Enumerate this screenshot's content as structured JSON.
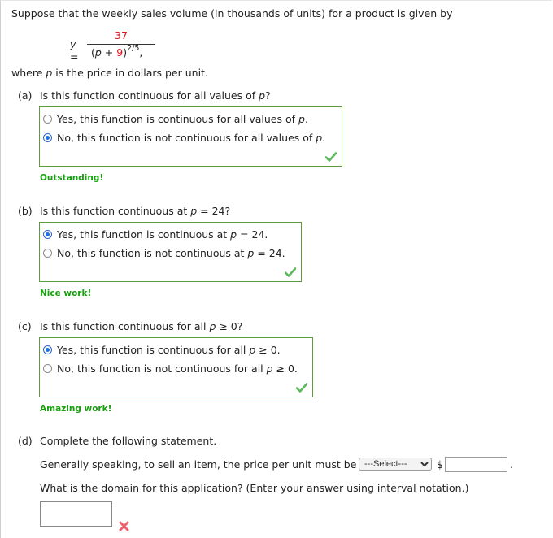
{
  "intro": {
    "text": "Suppose that the weekly sales volume (in thousands of units) for a product is given by",
    "formula": {
      "lhs": "y =",
      "numerator": "37",
      "denominator_open": "(",
      "denominator_var": "p",
      "denominator_plus": " + ",
      "denominator_const": "9",
      "denominator_close": ")",
      "exponent": "2/5",
      "trailing": ","
    },
    "where_prefix": "where ",
    "where_var": "p",
    "where_suffix": " is the price in dollars per unit."
  },
  "parts": [
    {
      "label": "(a)",
      "question_pre": "Is this function continuous for all values of ",
      "question_var": "p",
      "question_post": "?",
      "options": [
        {
          "pre": "Yes, this function is continuous for all values of ",
          "var": "p",
          "post": ".",
          "selected": false
        },
        {
          "pre": "No, this function is not continuous for all values of ",
          "var": "p",
          "post": ".",
          "selected": true
        }
      ],
      "status": "correct",
      "feedback": "Outstanding!"
    },
    {
      "label": "(b)",
      "question_pre": "Is this function continuous at ",
      "question_var": "p",
      "question_post": " = 24?",
      "options": [
        {
          "pre": "Yes, this function is continuous at ",
          "var": "p",
          "post": " = 24.",
          "selected": true
        },
        {
          "pre": "No, this function is not continuous at ",
          "var": "p",
          "post": " = 24.",
          "selected": false
        }
      ],
      "status": "correct",
      "feedback": "Nice work!"
    },
    {
      "label": "(c)",
      "question_pre": "Is this function continuous for all ",
      "question_var": "p",
      "question_post": " ≥ 0?",
      "options": [
        {
          "pre": "Yes, this function is continuous for all ",
          "var": "p",
          "post": " ≥ 0.",
          "selected": true
        },
        {
          "pre": "No, this function is not continuous for all ",
          "var": "p",
          "post": " ≥ 0.",
          "selected": false
        }
      ],
      "status": "correct",
      "feedback": "Amazing work!"
    },
    {
      "label": "(d)",
      "prompt": "Complete the following statement.",
      "statement_pre": "Generally speaking, to sell an item, the price per unit must be",
      "select_value": "---Select---",
      "currency": "$",
      "price_value": "",
      "statement_end": ".",
      "domain_question": "What is the domain for this application? (Enter your answer using interval notation.)",
      "domain_value": "",
      "status": "incorrect"
    }
  ],
  "colors": {
    "accent_red": "#e0151b",
    "correct_border": "#5d9c3a",
    "feedback_green": "#16a00e",
    "check_green": "#5cb85c",
    "cross_red": "#f0606a",
    "radio_selected": "#1f6fe5"
  },
  "icons": {
    "correct": "checkmark-icon",
    "incorrect": "cross-icon"
  }
}
